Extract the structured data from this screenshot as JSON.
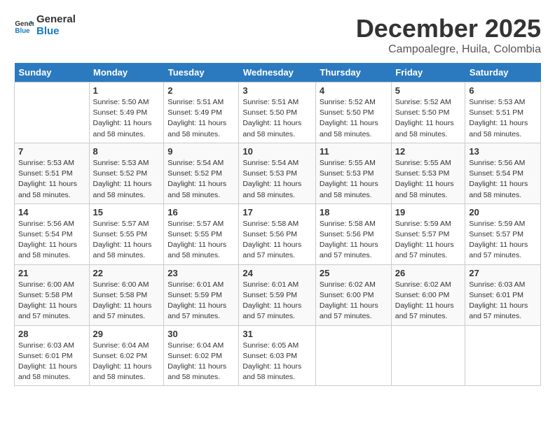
{
  "header": {
    "logo_line1": "General",
    "logo_line2": "Blue",
    "month": "December 2025",
    "location": "Campoalegre, Huila, Colombia"
  },
  "days_of_week": [
    "Sunday",
    "Monday",
    "Tuesday",
    "Wednesday",
    "Thursday",
    "Friday",
    "Saturday"
  ],
  "weeks": [
    [
      {
        "day": "",
        "info": ""
      },
      {
        "day": "1",
        "info": "Sunrise: 5:50 AM\nSunset: 5:49 PM\nDaylight: 11 hours\nand 58 minutes."
      },
      {
        "day": "2",
        "info": "Sunrise: 5:51 AM\nSunset: 5:49 PM\nDaylight: 11 hours\nand 58 minutes."
      },
      {
        "day": "3",
        "info": "Sunrise: 5:51 AM\nSunset: 5:50 PM\nDaylight: 11 hours\nand 58 minutes."
      },
      {
        "day": "4",
        "info": "Sunrise: 5:52 AM\nSunset: 5:50 PM\nDaylight: 11 hours\nand 58 minutes."
      },
      {
        "day": "5",
        "info": "Sunrise: 5:52 AM\nSunset: 5:50 PM\nDaylight: 11 hours\nand 58 minutes."
      },
      {
        "day": "6",
        "info": "Sunrise: 5:53 AM\nSunset: 5:51 PM\nDaylight: 11 hours\nand 58 minutes."
      }
    ],
    [
      {
        "day": "7",
        "info": "Sunrise: 5:53 AM\nSunset: 5:51 PM\nDaylight: 11 hours\nand 58 minutes."
      },
      {
        "day": "8",
        "info": "Sunrise: 5:53 AM\nSunset: 5:52 PM\nDaylight: 11 hours\nand 58 minutes."
      },
      {
        "day": "9",
        "info": "Sunrise: 5:54 AM\nSunset: 5:52 PM\nDaylight: 11 hours\nand 58 minutes."
      },
      {
        "day": "10",
        "info": "Sunrise: 5:54 AM\nSunset: 5:53 PM\nDaylight: 11 hours\nand 58 minutes."
      },
      {
        "day": "11",
        "info": "Sunrise: 5:55 AM\nSunset: 5:53 PM\nDaylight: 11 hours\nand 58 minutes."
      },
      {
        "day": "12",
        "info": "Sunrise: 5:55 AM\nSunset: 5:53 PM\nDaylight: 11 hours\nand 58 minutes."
      },
      {
        "day": "13",
        "info": "Sunrise: 5:56 AM\nSunset: 5:54 PM\nDaylight: 11 hours\nand 58 minutes."
      }
    ],
    [
      {
        "day": "14",
        "info": "Sunrise: 5:56 AM\nSunset: 5:54 PM\nDaylight: 11 hours\nand 58 minutes."
      },
      {
        "day": "15",
        "info": "Sunrise: 5:57 AM\nSunset: 5:55 PM\nDaylight: 11 hours\nand 58 minutes."
      },
      {
        "day": "16",
        "info": "Sunrise: 5:57 AM\nSunset: 5:55 PM\nDaylight: 11 hours\nand 58 minutes."
      },
      {
        "day": "17",
        "info": "Sunrise: 5:58 AM\nSunset: 5:56 PM\nDaylight: 11 hours\nand 57 minutes."
      },
      {
        "day": "18",
        "info": "Sunrise: 5:58 AM\nSunset: 5:56 PM\nDaylight: 11 hours\nand 57 minutes."
      },
      {
        "day": "19",
        "info": "Sunrise: 5:59 AM\nSunset: 5:57 PM\nDaylight: 11 hours\nand 57 minutes."
      },
      {
        "day": "20",
        "info": "Sunrise: 5:59 AM\nSunset: 5:57 PM\nDaylight: 11 hours\nand 57 minutes."
      }
    ],
    [
      {
        "day": "21",
        "info": "Sunrise: 6:00 AM\nSunset: 5:58 PM\nDaylight: 11 hours\nand 57 minutes."
      },
      {
        "day": "22",
        "info": "Sunrise: 6:00 AM\nSunset: 5:58 PM\nDaylight: 11 hours\nand 57 minutes."
      },
      {
        "day": "23",
        "info": "Sunrise: 6:01 AM\nSunset: 5:59 PM\nDaylight: 11 hours\nand 57 minutes."
      },
      {
        "day": "24",
        "info": "Sunrise: 6:01 AM\nSunset: 5:59 PM\nDaylight: 11 hours\nand 57 minutes."
      },
      {
        "day": "25",
        "info": "Sunrise: 6:02 AM\nSunset: 6:00 PM\nDaylight: 11 hours\nand 57 minutes."
      },
      {
        "day": "26",
        "info": "Sunrise: 6:02 AM\nSunset: 6:00 PM\nDaylight: 11 hours\nand 57 minutes."
      },
      {
        "day": "27",
        "info": "Sunrise: 6:03 AM\nSunset: 6:01 PM\nDaylight: 11 hours\nand 57 minutes."
      }
    ],
    [
      {
        "day": "28",
        "info": "Sunrise: 6:03 AM\nSunset: 6:01 PM\nDaylight: 11 hours\nand 58 minutes."
      },
      {
        "day": "29",
        "info": "Sunrise: 6:04 AM\nSunset: 6:02 PM\nDaylight: 11 hours\nand 58 minutes."
      },
      {
        "day": "30",
        "info": "Sunrise: 6:04 AM\nSunset: 6:02 PM\nDaylight: 11 hours\nand 58 minutes."
      },
      {
        "day": "31",
        "info": "Sunrise: 6:05 AM\nSunset: 6:03 PM\nDaylight: 11 hours\nand 58 minutes."
      },
      {
        "day": "",
        "info": ""
      },
      {
        "day": "",
        "info": ""
      },
      {
        "day": "",
        "info": ""
      }
    ]
  ]
}
